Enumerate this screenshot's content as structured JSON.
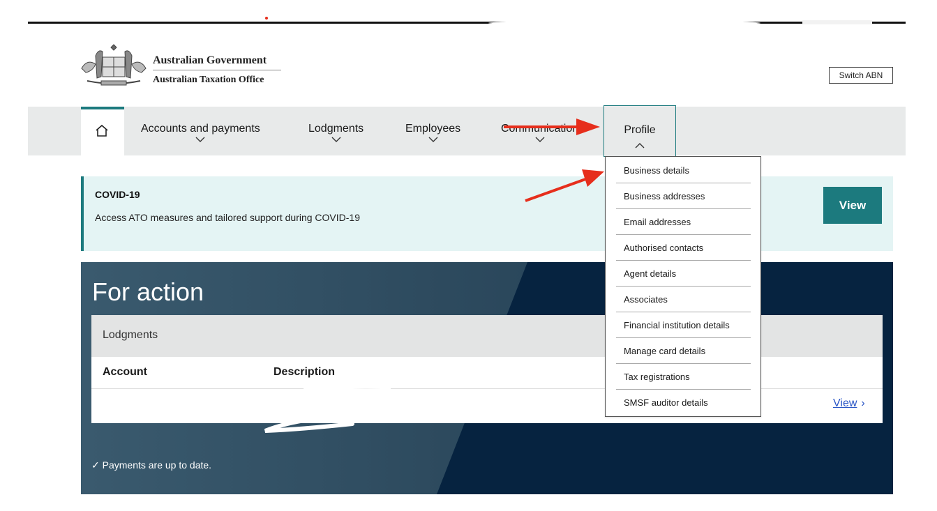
{
  "header": {
    "gov_line1": "Australian Government",
    "gov_line2": "Australian Taxation Office",
    "switch_abn": "Switch ABN"
  },
  "nav": {
    "home_icon": "home-icon",
    "items": [
      {
        "label": "Accounts and payments"
      },
      {
        "label": "Lodgments"
      },
      {
        "label": "Employees"
      },
      {
        "label": "Communication"
      },
      {
        "label": "Profile"
      }
    ]
  },
  "covid": {
    "title": "COVID-19",
    "description": "Access ATO measures and tailored support during COVID-19",
    "button": "View"
  },
  "for_action": {
    "heading": "For action",
    "category": "Lodgments",
    "columns": [
      "Account",
      "Description"
    ],
    "row_link": "View",
    "status": "Payments are up to date."
  },
  "profile_menu": [
    "Business details",
    "Business addresses",
    "Email addresses",
    "Authorised contacts",
    "Agent details",
    "Associates",
    "Financial institution details",
    "Manage card details",
    "Tax registrations",
    "SMSF auditor details"
  ],
  "colors": {
    "accent": "#1c7a7e",
    "annotation": "#e62e1c",
    "panel_dark": "#062340",
    "link": "#2a56c6"
  }
}
